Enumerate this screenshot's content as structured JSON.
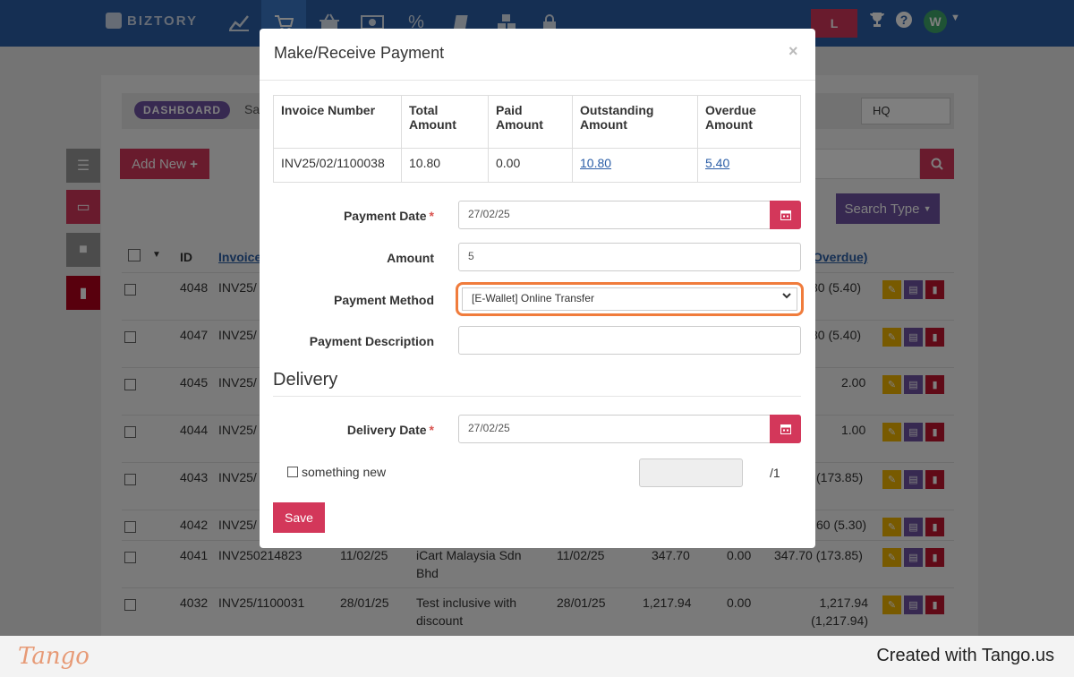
{
  "nav": {
    "brand": "BIZTORY",
    "icons": [
      "chart-line-icon",
      "cart-icon",
      "basket-icon",
      "money-icon",
      "percent-icon",
      "book-icon",
      "boxes-icon",
      "lock-icon"
    ],
    "user_badge": "L",
    "avatar_initial": "W"
  },
  "background": {
    "breadcrumb_badge": "DASHBOARD",
    "breadcrumb_text": "Sa",
    "branch_select": "HQ",
    "add_new": "Add New",
    "search_type": "Search Type",
    "headers": {
      "id": "ID",
      "invoice": "Invoice",
      "overdue": "Overdue)"
    },
    "rows": [
      {
        "id": "4048",
        "inv": "INV25/",
        "date1": "",
        "customer": "",
        "date2": "",
        "total": "",
        "paid": "",
        "overdue": "80 (5.40)"
      },
      {
        "id": "4047",
        "inv": "INV25/",
        "date1": "",
        "customer": "",
        "date2": "",
        "total": "",
        "paid": "",
        "overdue": "80 (5.40)"
      },
      {
        "id": "4045",
        "inv": "INV25/",
        "date1": "",
        "customer": "",
        "date2": "",
        "total": "",
        "paid": "",
        "overdue": "2.00"
      },
      {
        "id": "4044",
        "inv": "INV25/",
        "date1": "",
        "customer": "",
        "date2": "",
        "total": "",
        "paid": "",
        "overdue": "1.00"
      },
      {
        "id": "4043",
        "inv": "INV25/",
        "date1": "",
        "customer": "",
        "date2": "",
        "total": "",
        "paid": "",
        "overdue": "(173.85)"
      },
      {
        "id": "4042",
        "inv": "INV25/",
        "date1": "",
        "customer": "",
        "date2": "",
        "total": "",
        "paid": "",
        "overdue": "60 (5.30)"
      },
      {
        "id": "4041",
        "inv": "INV250214823",
        "date1": "11/02/25",
        "customer": "iCart Malaysia Sdn Bhd",
        "date2": "11/02/25",
        "total": "347.70",
        "paid": "0.00",
        "overdue": "347.70 (173.85)"
      },
      {
        "id": "4032",
        "inv": "INV25/1100031",
        "date1": "28/01/25",
        "customer": "Test inclusive with discount",
        "date2": "28/01/25",
        "total": "1,217.94",
        "paid": "0.00",
        "overdue": "1,217.94 (1,217.94)"
      }
    ]
  },
  "modal": {
    "title": "Make/Receive Payment",
    "close": "×",
    "table": {
      "headers": [
        "Invoice Number",
        "Total Amount",
        "Paid Amount",
        "Outstanding Amount",
        "Overdue Amount"
      ],
      "row": {
        "invoice_number": "INV25/02/1100038",
        "total": "10.80",
        "paid": "0.00",
        "outstanding": "10.80",
        "overdue": "5.40"
      }
    },
    "payment_date_label": "Payment Date",
    "payment_date_value": "27/02/25",
    "amount_label": "Amount",
    "amount_value": "5",
    "payment_method_label": "Payment Method",
    "payment_method_value": "[E-Wallet] Online Transfer",
    "payment_description_label": "Payment Description",
    "payment_description_value": "",
    "delivery_section": "Delivery",
    "delivery_date_label": "Delivery Date",
    "delivery_date_value": "27/02/25",
    "checkbox_label": "something new",
    "count_total": "/1",
    "save": "Save",
    "required_mark": "*"
  },
  "footer": {
    "logo": "Tango",
    "credit": "Created with Tango.us"
  },
  "colors": {
    "nav": "#2b5ea7",
    "accent": "#d3375a",
    "purple": "#6e52a2",
    "highlight": "#f07c3c"
  }
}
